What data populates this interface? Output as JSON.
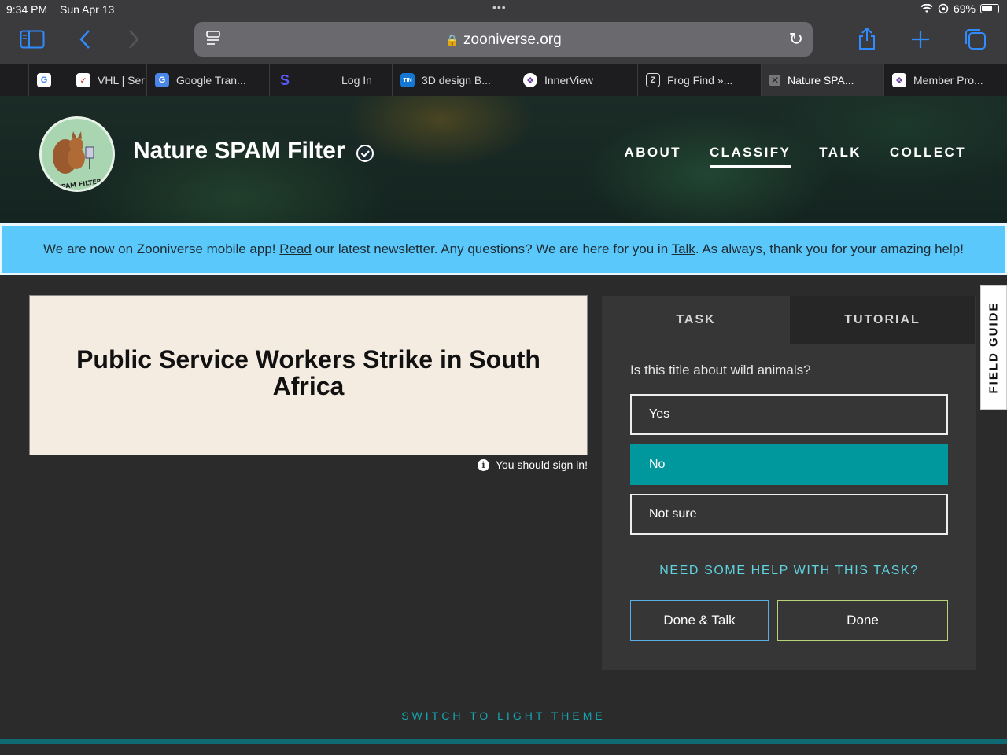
{
  "status_bar": {
    "time": "9:34 PM",
    "date": "Sun Apr 13",
    "battery": "69%"
  },
  "browser": {
    "url": "zooniverse.org"
  },
  "tabs": [
    {
      "label": "",
      "icon": "google-icon"
    },
    {
      "label": "VHL | Ser",
      "icon": "vhl-icon"
    },
    {
      "label": "Google Tran...",
      "icon": "google-translate-icon"
    },
    {
      "label": "",
      "icon": "s-icon"
    },
    {
      "label": "Log In",
      "icon": ""
    },
    {
      "label": "3D design B...",
      "icon": "tinkercad-icon"
    },
    {
      "label": "InnerView",
      "icon": "innerview-icon"
    },
    {
      "label": "Frog Find »...",
      "icon": "z-icon"
    },
    {
      "label": "Nature SPA...",
      "icon": "close-icon"
    },
    {
      "label": "Member Pro...",
      "icon": "innerview-icon"
    }
  ],
  "project": {
    "title": "Nature SPAM Filter",
    "nav": [
      "ABOUT",
      "CLASSIFY",
      "TALK",
      "COLLECT"
    ]
  },
  "banner": {
    "part1": "We are now on Zooniverse mobile app! ",
    "link1": "Read",
    "part2": " our latest newsletter. Any questions? We are here for you in ",
    "link2": "Talk",
    "part3": ". As always, thank you for your amazing help!"
  },
  "subject": {
    "text": "Public Service Workers Strike in South Africa",
    "signin": "You should sign in!"
  },
  "task_panel": {
    "tabs": [
      "TASK",
      "TUTORIAL"
    ],
    "question": "Is this title about wild animals?",
    "answers": [
      "Yes",
      "No",
      "Not sure"
    ],
    "selected_answer": "No",
    "help": "NEED SOME HELP WITH THIS TASK?",
    "done_talk": "Done & Talk",
    "done": "Done"
  },
  "field_guide": "FIELD GUIDE",
  "theme_switch": "SWITCH TO LIGHT THEME"
}
